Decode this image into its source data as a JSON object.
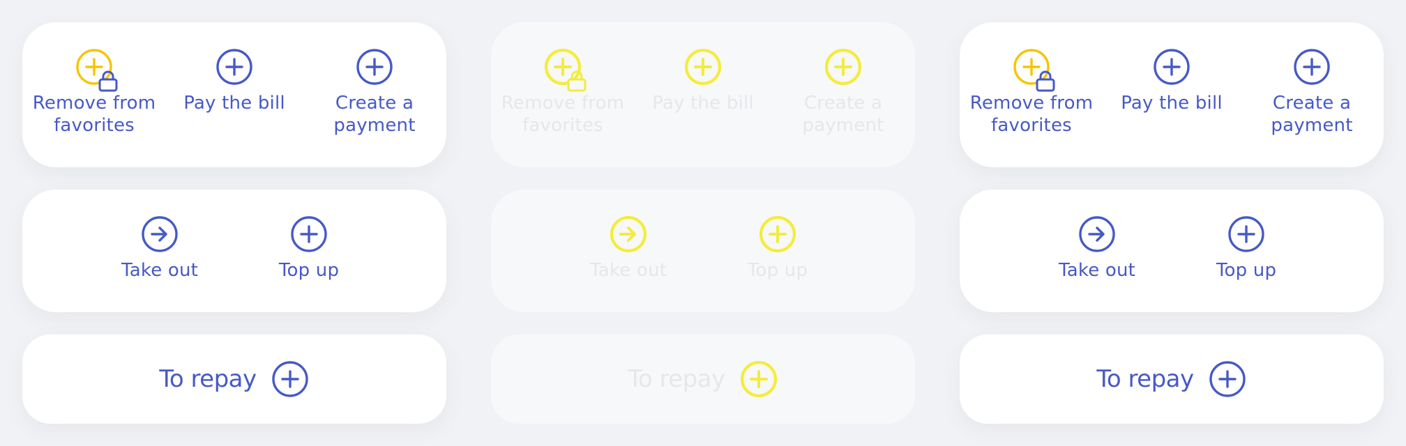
{
  "colors": {
    "primary": "#4659c6",
    "accent": "#f7c400",
    "disabled_text": "#e6e7ea",
    "disabled_icon": "#f3ec3a",
    "card_bg": "#ffffff",
    "page_bg": "#f1f2f5"
  },
  "panels": [
    {
      "state": "default",
      "actions": [
        {
          "label_1": "Remove from",
          "label_2": "favorites",
          "icon": "plus-circle-lock-icon"
        },
        {
          "label_1": "Pay the bill",
          "label_2": "",
          "icon": "plus-circle-icon"
        },
        {
          "label_1": "Create a",
          "label_2": "payment",
          "icon": "plus-circle-icon"
        }
      ],
      "transfer": [
        {
          "label": "Take out",
          "icon": "arrow-right-circle-icon"
        },
        {
          "label": "Top up",
          "icon": "plus-circle-icon"
        }
      ],
      "repay": {
        "label": "To repay",
        "icon": "plus-circle-icon"
      }
    },
    {
      "state": "disabled",
      "actions": [
        {
          "label_1": "Remove from",
          "label_2": "favorites",
          "icon": "plus-circle-lock-icon"
        },
        {
          "label_1": "Pay the bill",
          "label_2": "",
          "icon": "plus-circle-icon"
        },
        {
          "label_1": "Create a",
          "label_2": "payment",
          "icon": "plus-circle-icon"
        }
      ],
      "transfer": [
        {
          "label": "Take out",
          "icon": "arrow-right-circle-icon"
        },
        {
          "label": "Top up",
          "icon": "plus-circle-icon"
        }
      ],
      "repay": {
        "label": "To repay",
        "icon": "plus-circle-icon"
      }
    },
    {
      "state": "default",
      "actions": [
        {
          "label_1": "Remove from",
          "label_2": "favorites",
          "icon": "plus-circle-lock-icon"
        },
        {
          "label_1": "Pay the bill",
          "label_2": "",
          "icon": "plus-circle-icon"
        },
        {
          "label_1": "Create a",
          "label_2": "payment",
          "icon": "plus-circle-icon"
        }
      ],
      "transfer": [
        {
          "label": "Take out",
          "icon": "arrow-right-circle-icon"
        },
        {
          "label": "Top up",
          "icon": "plus-circle-icon"
        }
      ],
      "repay": {
        "label": "To repay",
        "icon": "plus-circle-icon"
      }
    }
  ]
}
